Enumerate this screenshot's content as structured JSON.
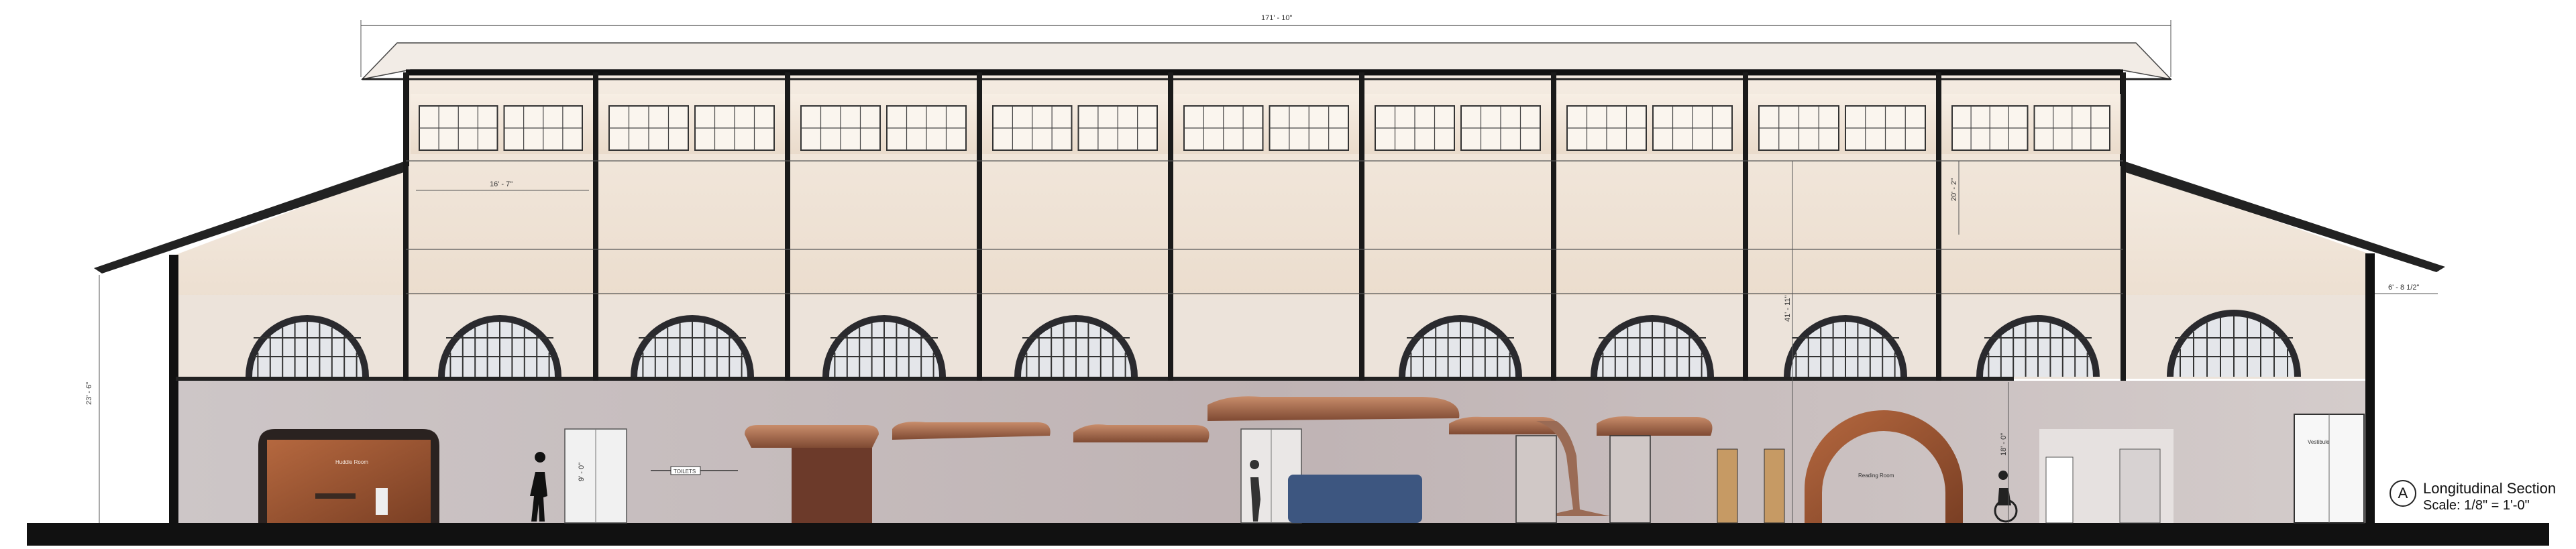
{
  "drawing": {
    "dimensions": {
      "overall_length": "171' - 10\"",
      "bay_width": "16' - 7\"",
      "clerestory_height": "20' - 2\"",
      "total_height": "41' - 11\"",
      "side_height": "23' - 6\"",
      "lower_ceiling": "18' - 0\"",
      "right_wing": "6' - 8 1/2\"",
      "person_height": "9' - 0\""
    },
    "room_labels": {
      "huddle_room": "Huddle Room",
      "toilets": "TOILETS",
      "toilets_sign": "TOILETS",
      "reading_room": "Reading Room",
      "vestibule": "Vestibule"
    },
    "title": {
      "marker": "A",
      "name": "Longitudinal Section",
      "scale": "Scale: 1/8\" = 1'-0\""
    }
  }
}
